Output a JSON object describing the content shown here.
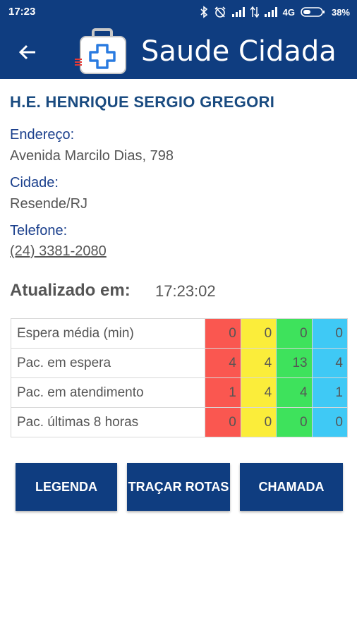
{
  "status_bar": {
    "time": "17:23",
    "network": "4G",
    "battery": "38%",
    "icons": [
      "bluetooth-icon",
      "alarm-off-icon",
      "signal-icon",
      "data-arrows-icon",
      "signal-icon",
      "battery-icon"
    ]
  },
  "app_bar": {
    "title": "Saude Cidada",
    "back_icon": "arrow-back-icon",
    "logo_icon": "medical-kit-icon"
  },
  "hospital": {
    "name": "H.E. HENRIQUE SERGIO GREGORI",
    "address_label": "Endereço:",
    "address": "Avenida Marcilo Dias, 798",
    "city_label": "Cidade:",
    "city": "Resende/RJ",
    "phone_label": "Telefone:",
    "phone": "(24) 3381-2080"
  },
  "updated": {
    "label": "Atualizado em:",
    "time": "17:23:02"
  },
  "table": {
    "color_columns": [
      "#fa5750",
      "#fbed3a",
      "#3ee25c",
      "#3fc9f5"
    ],
    "rows": [
      {
        "label": "Espera média (min)",
        "values": [
          "0",
          "0",
          "0",
          "0"
        ]
      },
      {
        "label": "Pac. em espera",
        "values": [
          "4",
          "4",
          "13",
          "4"
        ]
      },
      {
        "label": "Pac. em atendimento",
        "values": [
          "1",
          "4",
          "4",
          "1"
        ]
      },
      {
        "label": "Pac. últimas 8 horas",
        "values": [
          "0",
          "0",
          "0",
          "0"
        ]
      }
    ]
  },
  "buttons": {
    "legend": "LEGENDA",
    "routes": "TRAÇAR ROTAS",
    "call": "CHAMADA"
  }
}
